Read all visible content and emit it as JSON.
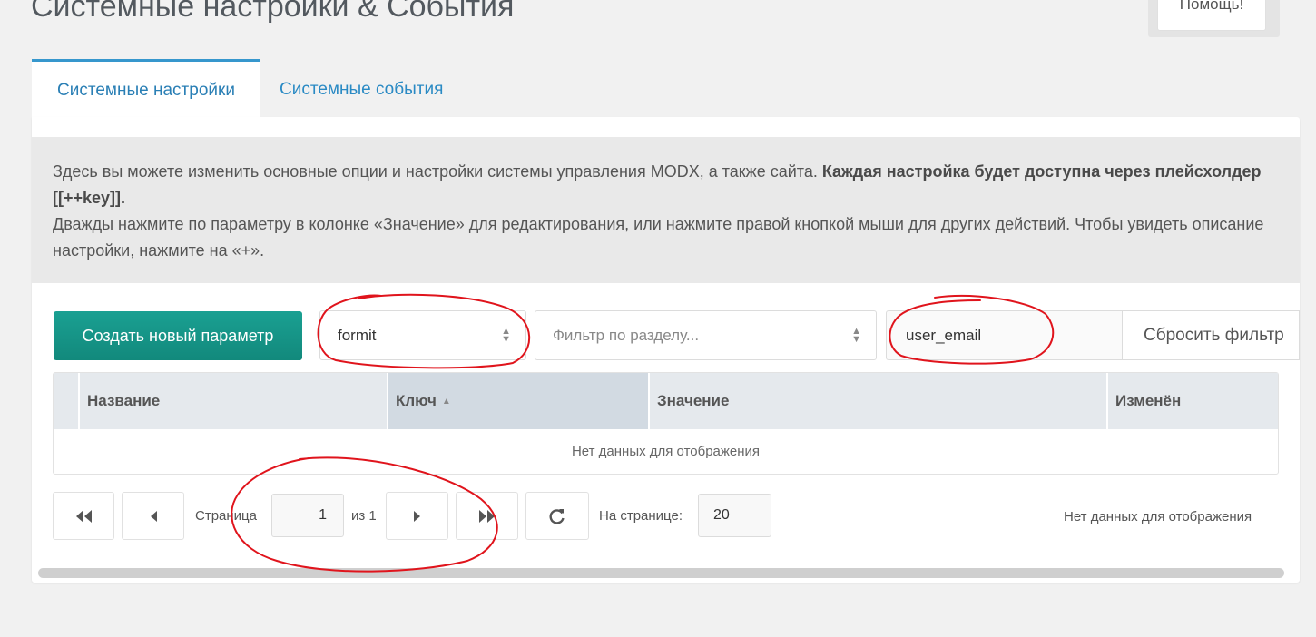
{
  "header": {
    "title": "Системные настройки & События",
    "help_label": "Помощь!"
  },
  "tabs": [
    {
      "label": "Системные настройки",
      "active": true
    },
    {
      "label": "Системные события",
      "active": false
    }
  ],
  "description": {
    "line1_normal": "Здесь вы можете изменить основные опции и настройки системы управления MODX, а также сайта. ",
    "line1_bold": "Каждая настройка будет доступна через плейсхолдер [[++key]].",
    "line2": "Дважды нажмите по параметру в колонке «Значение» для редактирования, или нажмите правой кнопкой мыши для других действий. Чтобы увидеть описание настройки, нажмите на «+»."
  },
  "toolbar": {
    "create_label": "Создать новый параметр",
    "namespace_value": "formit",
    "area_placeholder": "Фильтр по разделу...",
    "search_value": "user_email",
    "reset_label": "Сбросить фильтр"
  },
  "grid": {
    "columns": [
      "Название",
      "Ключ",
      "Значение",
      "Изменён"
    ],
    "sorted_column": "Ключ",
    "sort_direction": "asc",
    "empty_text": "Нет данных для отображения"
  },
  "pager": {
    "page_label": "Страница",
    "page_value": "1",
    "of_label": "из 1",
    "per_page_label": "На странице:",
    "per_page_value": "20",
    "status_text": "Нет данных для отображения"
  },
  "colors": {
    "accent": "#3697cd",
    "create_button": "#12897c",
    "annotation": "#e0141c"
  },
  "icons": [
    "first-page-icon",
    "prev-page-icon",
    "next-page-icon",
    "last-page-icon",
    "refresh-icon",
    "sort-asc-icon",
    "updown-arrows-icon"
  ]
}
